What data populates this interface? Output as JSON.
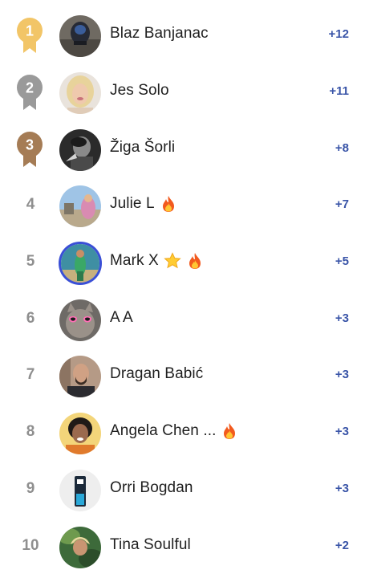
{
  "colors": {
    "gold": "#f2c567",
    "silver": "#9a9a9a",
    "bronze": "#a57c55",
    "score": "#3a55a8",
    "rank_plain": "#8f8f8f",
    "avatar_ring": "#3a4fd6"
  },
  "leaderboard": {
    "rows": [
      {
        "rank": "1",
        "medal": "gold",
        "name": "Blaz Banjanac",
        "badges": [],
        "score": "+12",
        "avatar": "avatar-car-photo"
      },
      {
        "rank": "2",
        "medal": "silver",
        "name": "Jes Solo",
        "badges": [],
        "score": "+11",
        "avatar": "avatar-blonde-woman-photo"
      },
      {
        "rank": "3",
        "medal": "bronze",
        "name": "Žiga Šorli",
        "badges": [],
        "score": "+8",
        "avatar": "avatar-bw-portrait-photo"
      },
      {
        "rank": "4",
        "medal": null,
        "name": "Julie L",
        "badges": [
          "fire-icon"
        ],
        "score": "+7",
        "avatar": "avatar-outdoor-photo"
      },
      {
        "rank": "5",
        "medal": null,
        "name": "Mark X",
        "badges": [
          "star-icon",
          "fire-icon"
        ],
        "score": "+5",
        "avatar": "avatar-beach-photo"
      },
      {
        "rank": "6",
        "medal": null,
        "name": "A A",
        "badges": [],
        "score": "+3",
        "avatar": "avatar-cat-sunglasses-photo"
      },
      {
        "rank": "7",
        "medal": null,
        "name": "Dragan Babić",
        "badges": [],
        "score": "+3",
        "avatar": "avatar-man-portrait-photo"
      },
      {
        "rank": "8",
        "medal": null,
        "name": "Angela Chen ...",
        "badges": [
          "fire-icon"
        ],
        "score": "+3",
        "avatar": "avatar-woman-portrait-photo"
      },
      {
        "rank": "9",
        "medal": null,
        "name": "Orri Bogdan",
        "badges": [],
        "score": "+3",
        "avatar": "avatar-product-photo"
      },
      {
        "rank": "10",
        "medal": null,
        "name": "Tina Soulful",
        "badges": [],
        "score": "+2",
        "avatar": "avatar-nature-photo"
      }
    ]
  }
}
